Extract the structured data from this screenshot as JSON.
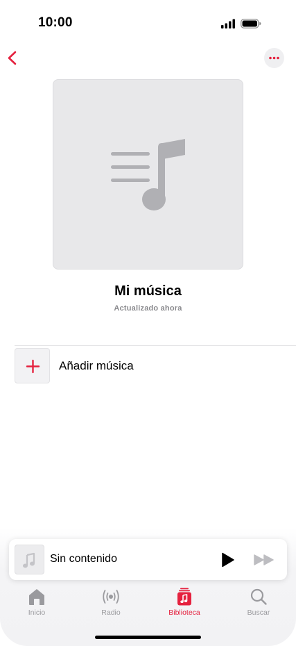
{
  "status_bar": {
    "time": "10:00",
    "icons": [
      "signal-icon",
      "battery-icon"
    ]
  },
  "nav": {
    "back_icon": "chevron-left-icon",
    "more_icon": "ellipsis-icon"
  },
  "playlist": {
    "artwork_icon": "music-list-icon",
    "title": "Mi música",
    "subtitle": "Actualizado ahora"
  },
  "actions": {
    "add_music_icon": "plus-icon",
    "add_music_label": "Añadir música"
  },
  "mini_player": {
    "art_icon": "music-note-icon",
    "title": "Sin contenido",
    "play_icon": "play-icon",
    "forward_icon": "forward-icon"
  },
  "tabs": [
    {
      "label": "Inicio",
      "icon": "home-icon",
      "active": false
    },
    {
      "label": "Radio",
      "icon": "radio-icon",
      "active": false
    },
    {
      "label": "Biblioteca",
      "icon": "library-icon",
      "active": true
    },
    {
      "label": "Buscar",
      "icon": "search-icon",
      "active": false
    }
  ],
  "colors": {
    "accent": "#e5213e",
    "inactive_tab": "#9a9a9e",
    "secondary_text": "#8a8a8e",
    "artwork_bg": "#e8e8ea"
  }
}
